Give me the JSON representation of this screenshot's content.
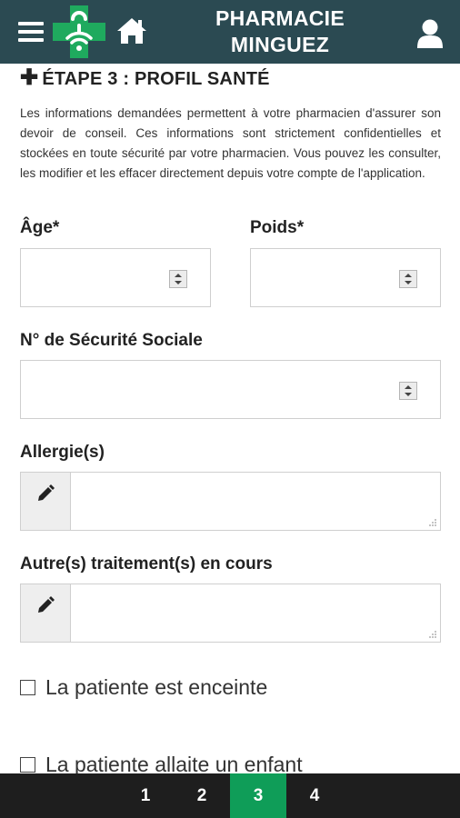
{
  "header": {
    "title_line1": "PHARMACIE",
    "title_line2": "MINGUEZ",
    "icons": {
      "menu": "hamburger-menu-icon",
      "logo": "pharmacy-cross-logo",
      "home": "home-icon",
      "user": "user-account-icon"
    },
    "colors": {
      "background": "#2b4a52",
      "logo_green": "#1faa5e"
    }
  },
  "step": {
    "title": "ÉTAPE 3 : PROFIL SANTÉ",
    "plus_icon": "plus-icon",
    "intro": "Les informations demandées permettent à votre pharmacien d'assurer son devoir de conseil. Ces informations sont strictement confidentielles et stockées en toute sécurité par votre pharmacien. Vous pouvez les consulter, les modifier et les effacer directement depuis votre compte de l'application."
  },
  "form": {
    "age_label": "Âge*",
    "age_value": "",
    "weight_label": "Poids*",
    "weight_value": "",
    "ssn_label": "N° de Sécurité Sociale",
    "ssn_value": "",
    "allergies_label": "Allergie(s)",
    "allergies_value": "",
    "treatments_label": "Autre(s) traitement(s) en cours",
    "treatments_value": "",
    "pregnant_label": "La patiente est enceinte",
    "pregnant_checked": false,
    "breastfeeding_label": "La patiente allaite un enfant",
    "breastfeeding_checked": false
  },
  "bottom_nav": {
    "steps": [
      "1",
      "2",
      "3",
      "4"
    ],
    "active_step": "3",
    "colors": {
      "background": "#1e1e1e",
      "active": "#0f9d58"
    }
  }
}
